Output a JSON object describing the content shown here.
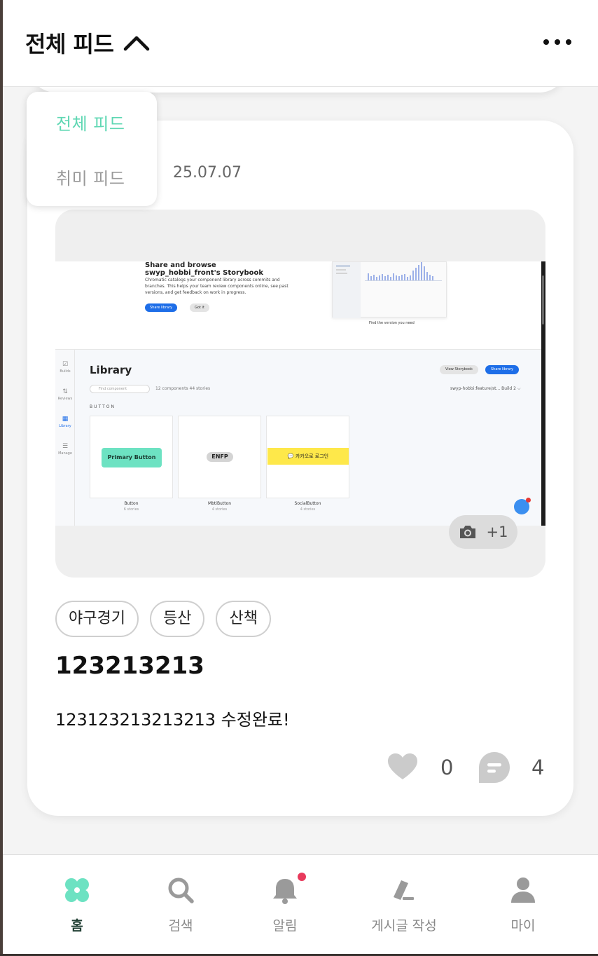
{
  "header": {
    "title": "전체 피드",
    "chevron_icon": "chevron-up-icon",
    "more_icon": "more-horizontal-icon"
  },
  "feed_menu": {
    "items": [
      {
        "label": "전체 피드",
        "active": true
      },
      {
        "label": "취미 피드",
        "active": false
      }
    ],
    "active_color": "#5fd7b3"
  },
  "post": {
    "date": "25.07.07",
    "photo_count": "+1",
    "tags": [
      "야구경기",
      "등산",
      "산책"
    ],
    "title": "123213213",
    "body": "123123213213213 수정완료!",
    "likes": "0",
    "comments": "4",
    "screenshot": {
      "heading": "Share and browse swyp_hobbi_front's Storybook",
      "description": "Chromatic catalogs your component library across commits and branches. This helps your team review components online, see past versions, and get feedback on work in progress.",
      "share_button": "Share library",
      "got_it_button": "Got it",
      "preview_caption": "Find the version you need",
      "sidebar": [
        {
          "icon": "☑",
          "label": "Builds"
        },
        {
          "icon": "⇅",
          "label": "Reviews"
        },
        {
          "icon": "▦",
          "label": "Library"
        },
        {
          "icon": "☰",
          "label": "Manage"
        }
      ],
      "library_title": "Library",
      "search_placeholder": "Find component",
      "component_count": "12 components   44 stories",
      "view_storybook": "View Storybook",
      "share_library": "Share library",
      "branch": "swyp-hobbi:feature/st... Build 2 ⌵",
      "section": "BUTTON",
      "tiles": [
        {
          "button": "Primary Button",
          "name": "Button",
          "stories": "6 stories",
          "color": "#6de2c2"
        },
        {
          "button": "ENFP",
          "name": "MbtiButton",
          "stories": "4 stories",
          "color": "#d4d4d4"
        },
        {
          "button": "💬 카카오로 로그인",
          "name": "SocialButton",
          "stories": "4 stories",
          "color": "#fee84a"
        }
      ]
    }
  },
  "nav": {
    "items": [
      {
        "label": "홈",
        "icon": "clover-home-icon",
        "active": true
      },
      {
        "label": "검색",
        "icon": "search-icon",
        "active": false
      },
      {
        "label": "알림",
        "icon": "bell-icon",
        "active": false
      },
      {
        "label": "게시글 작성",
        "icon": "pencil-icon",
        "active": false
      },
      {
        "label": "마이",
        "icon": "user-icon",
        "active": false
      }
    ],
    "accent": "#6de2c2",
    "notification_dot_color": "#e83a5c"
  }
}
